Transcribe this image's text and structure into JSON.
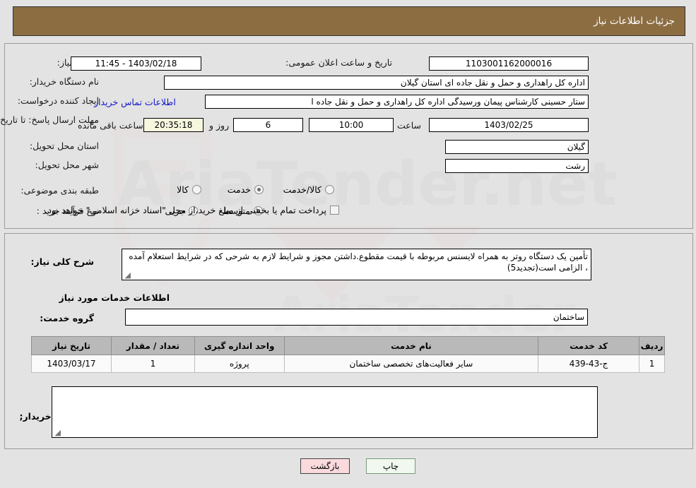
{
  "header": {
    "title": "جزئیات اطلاعات نیاز"
  },
  "watermark": {
    "text": "AriaTender.net"
  },
  "top_form": {
    "need_number": {
      "label": "شماره نیاز:",
      "value": "1103001162000016"
    },
    "buyer_org": {
      "label": "نام دستگاه خریدار:",
      "value": "اداره کل راهداری و حمل و نقل جاده ای استان گیلان"
    },
    "requester": {
      "label": "ایجاد کننده درخواست:",
      "value": "ستار حسینی کارشناس پیمان ورسیدگی اداره کل راهداری و حمل و نقل جاده ا",
      "link": "اطلاعات تماس خریدار"
    },
    "announce": {
      "label": "تاریخ و ساعت اعلان عمومی:",
      "value": "1403/02/18 - 11:45"
    },
    "deadline": {
      "label": "مهلت ارسال پاسخ: تا تاریخ:",
      "date": "1403/02/25",
      "time_label": "ساعت",
      "time": "10:00",
      "days": "6",
      "days_label": "روز و",
      "countdown": "20:35:18",
      "remaining_label": "ساعت باقی مانده"
    },
    "province": {
      "label": "استان محل تحویل:",
      "value": "گیلان"
    },
    "city": {
      "label": "شهر محل تحویل:",
      "value": "رشت"
    },
    "category": {
      "label": "طبقه بندی موضوعی:",
      "options": [
        "کالا",
        "خدمت",
        "کالا/خدمت"
      ],
      "selected_index": 1
    },
    "purchase_type": {
      "label": "نوع فرآیند خرید :",
      "options": [
        "جزیی",
        "متوسط"
      ],
      "selected_index": 1,
      "checkbox_checked": false,
      "checkbox_text": "پرداخت تمام یا بخشی از مبلغ خرید،از محل \"اسناد خزانه اسلامی\" خواهد بود."
    }
  },
  "middle": {
    "general_desc": {
      "label": "شرح کلی نیاز:",
      "value": "تأمین یک دستگاه روتر به همراه لایسنس مربوطه با قیمت مقطوع.داشتن مجوز و شرایط لازم به شرحی که در شرایط استعلام آمده ، الزامی است(تجدید5)"
    },
    "services_title": "اطلاعات خدمات مورد نیاز",
    "service_group": {
      "label": "گروه خدمت:",
      "value": "ساختمان"
    },
    "table": {
      "columns": [
        "ردیف",
        "کد خدمت",
        "نام خدمت",
        "واحد اندازه گیری",
        "تعداد / مقدار",
        "تاریخ نیاز"
      ],
      "rows": [
        {
          "row_no": "1",
          "service_code": "ج-43-439",
          "service_name": "سایر فعالیت‌های تخصصی ساختمان",
          "unit": "پروژه",
          "quantity": "1",
          "need_date": "1403/03/17"
        }
      ]
    },
    "buyer_notes": {
      "label": "توضیحات خریدار;",
      "value": ""
    }
  },
  "footer": {
    "back_button": "بازگشت",
    "print_button": "چاپ"
  }
}
